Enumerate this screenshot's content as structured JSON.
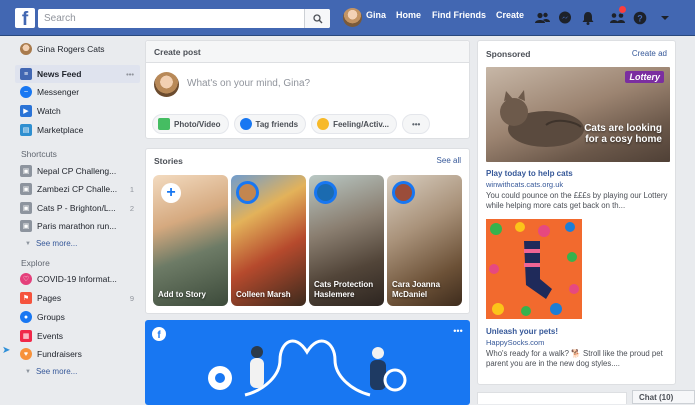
{
  "topbar": {
    "search_placeholder": "Search",
    "user_name": "Gina",
    "nav": [
      "Home",
      "Find Friends",
      "Create"
    ],
    "icons": [
      "friends-icon",
      "messenger-icon",
      "notifications-icon",
      "quick-help-icon",
      "help-icon",
      "account-menu-icon"
    ]
  },
  "left": {
    "profile": "Gina Rogers Cats",
    "main_items": [
      {
        "label": "News Feed",
        "icon": "news-feed-icon",
        "more": "•••"
      },
      {
        "label": "Messenger",
        "icon": "messenger-icon"
      },
      {
        "label": "Watch",
        "icon": "watch-icon"
      },
      {
        "label": "Marketplace",
        "icon": "marketplace-icon"
      }
    ],
    "shortcuts_title": "Shortcuts",
    "shortcuts": [
      {
        "label": "Nepal CP Challeng...",
        "count": ""
      },
      {
        "label": "Zambezi CP Challe...",
        "count": "1"
      },
      {
        "label": "Cats P - Brighton/L...",
        "count": "2"
      },
      {
        "label": "Paris marathon run...",
        "count": ""
      }
    ],
    "see_more": "See more...",
    "explore_title": "Explore",
    "explore": [
      {
        "label": "COVID-19 Informat...",
        "count": "",
        "color": "#e4407b"
      },
      {
        "label": "Pages",
        "count": "9",
        "color": "#f5533d"
      },
      {
        "label": "Groups",
        "count": "",
        "color": "#1877f2"
      },
      {
        "label": "Events",
        "count": "",
        "color": "#f02849"
      },
      {
        "label": "Fundraisers",
        "count": "",
        "color": "#f7923b"
      }
    ],
    "see_more_2": "See more..."
  },
  "create_post": {
    "title": "Create post",
    "placeholder": "What's on your mind, Gina?",
    "actions": [
      {
        "label": "Photo/Video",
        "color": "#45bd62"
      },
      {
        "label": "Tag friends",
        "color": "#1877f2"
      },
      {
        "label": "Feeling/Activ...",
        "color": "#f7b928"
      },
      {
        "label": "•••",
        "color": ""
      }
    ]
  },
  "stories": {
    "title": "Stories",
    "see_all": "See all",
    "cards": [
      {
        "name": "Add to Story"
      },
      {
        "name": "Colleen Marsh"
      },
      {
        "name": "Cats Protection Haslemere"
      },
      {
        "name": "Cara Joanna McDaniel"
      }
    ]
  },
  "sponsored": {
    "title": "Sponsored",
    "create_ad": "Create ad",
    "ads": [
      {
        "image_text": "Cats are looking for a cosy home",
        "brand_badge": "Lottery",
        "title": "Play today to help cats",
        "domain": "winwithcats.cats.org.uk",
        "desc": "You could pounce on the £££s by playing our Lottery while helping more cats get back on th..."
      },
      {
        "title": "Unleash your pets!",
        "domain": "HappySocks.com",
        "desc": "Who's ready for a walk? 🐕 Stroll like the proud pet parent you are in the new dog styles...."
      }
    ]
  },
  "chat": {
    "label": "Chat (10)"
  },
  "colors": {
    "brand": "#4267b2",
    "accent": "#1877f2",
    "background": "#e9ebee"
  }
}
